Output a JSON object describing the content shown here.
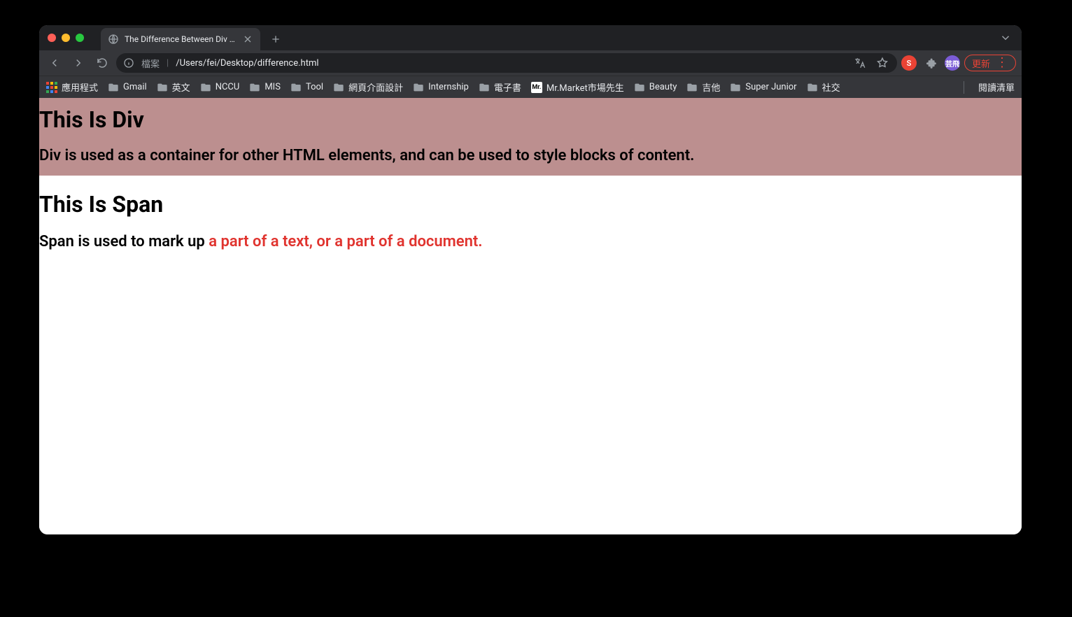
{
  "tab": {
    "title": "The Difference Between Div an"
  },
  "address": {
    "source_label": "檔案",
    "path": "/Users/fei/Desktop/difference.html"
  },
  "toolbar": {
    "avatar_s": "S",
    "avatar_profile": "芸飛",
    "update_label": "更新"
  },
  "bookmarks": {
    "apps": "應用程式",
    "items": [
      "Gmail",
      "英文",
      "NCCU",
      "MIS",
      "Tool",
      "網頁介面設計",
      "Internship",
      "電子書"
    ],
    "mr_label": "Mr.Market市場先生",
    "mr_badge": "Mr.",
    "items2": [
      "Beauty",
      "吉他",
      "Super Junior",
      "社交"
    ],
    "reading_list": "閱讀清單"
  },
  "page": {
    "div_heading": "This Is Div",
    "div_text": "Div is used as a container for other HTML elements, and can be used to style blocks of content.",
    "span_heading": "This Is Span",
    "span_text_lead": "Span is used to mark up ",
    "span_text_highlight": "a part of a text, or a part of a document."
  }
}
